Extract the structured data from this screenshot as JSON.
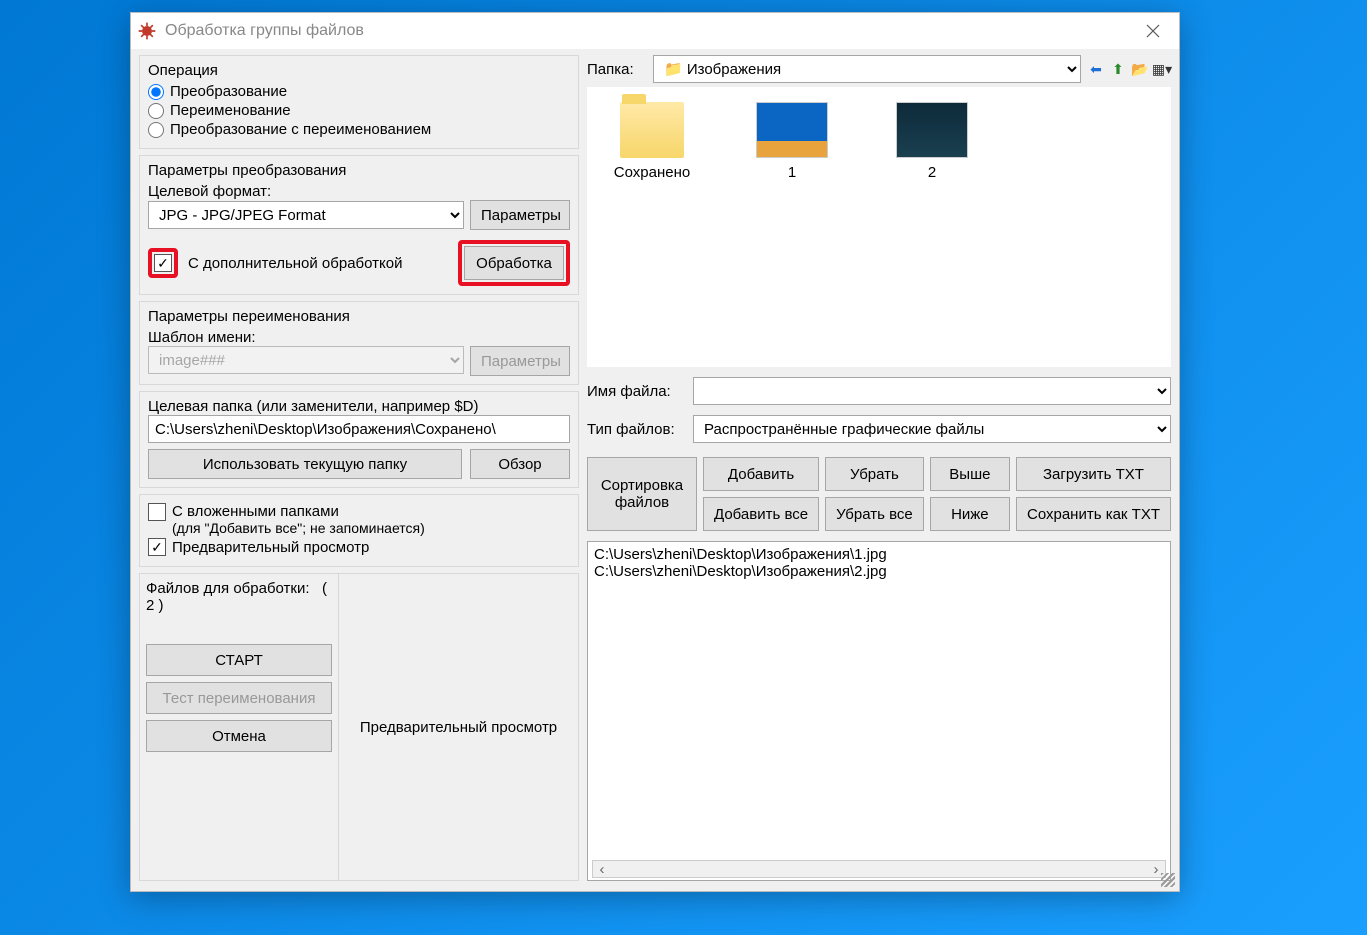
{
  "window": {
    "title": "Обработка группы файлов"
  },
  "operation": {
    "group_title": "Операция",
    "opt_convert": "Преобразование",
    "opt_rename": "Переименование",
    "opt_both": "Преобразование с переименованием"
  },
  "conversion": {
    "group_title": "Параметры преобразования",
    "target_format_label": "Целевой формат:",
    "target_format_value": "JPG - JPG/JPEG Format",
    "params_btn": "Параметры",
    "extra_processing_label": "С дополнительной обработкой",
    "processing_btn": "Обработка"
  },
  "rename": {
    "group_title": "Параметры переименования",
    "template_label": "Шаблон имени:",
    "template_value": "image###",
    "params_btn": "Параметры"
  },
  "target_folder": {
    "label": "Целевая папка (или заменители, например $D)",
    "value": "C:\\Users\\zheni\\Desktop\\Изображения\\Сохранено\\",
    "use_current_btn": "Использовать текущую папку",
    "browse_btn": "Обзор"
  },
  "options": {
    "subfolders_label": "С вложенными папками",
    "subfolders_hint": "(для \"Добавить все\"; не запоминается)",
    "preview_label": "Предварительный просмотр"
  },
  "footer": {
    "files_for_processing_label": "Файлов для обработки:",
    "count": "( 2 )",
    "start_btn": "СТАРТ",
    "test_rename_btn": "Тест переименования",
    "cancel_btn": "Отмена",
    "preview_panel_label": "Предварительный просмотр"
  },
  "right": {
    "folder_label": "Папка:",
    "folder_value": "Изображения",
    "items": [
      {
        "name": "Сохранено",
        "kind": "folder"
      },
      {
        "name": "1",
        "kind": "thumb-desktop"
      },
      {
        "name": "2",
        "kind": "thumb-city"
      }
    ],
    "filename_label": "Имя файла:",
    "filename_value": "",
    "filetype_label": "Тип файлов:",
    "filetype_value": "Распространённые графические файлы",
    "sort_label": "Сортировка файлов",
    "btn_add": "Добавить",
    "btn_remove": "Убрать",
    "btn_up": "Выше",
    "btn_load_txt": "Загрузить TXT",
    "btn_add_all": "Добавить все",
    "btn_remove_all": "Убрать все",
    "btn_down": "Ниже",
    "btn_save_txt": "Сохранить как TXT",
    "file_list": [
      "C:\\Users\\zheni\\Desktop\\Изображения\\1.jpg",
      "C:\\Users\\zheni\\Desktop\\Изображения\\2.jpg"
    ]
  }
}
